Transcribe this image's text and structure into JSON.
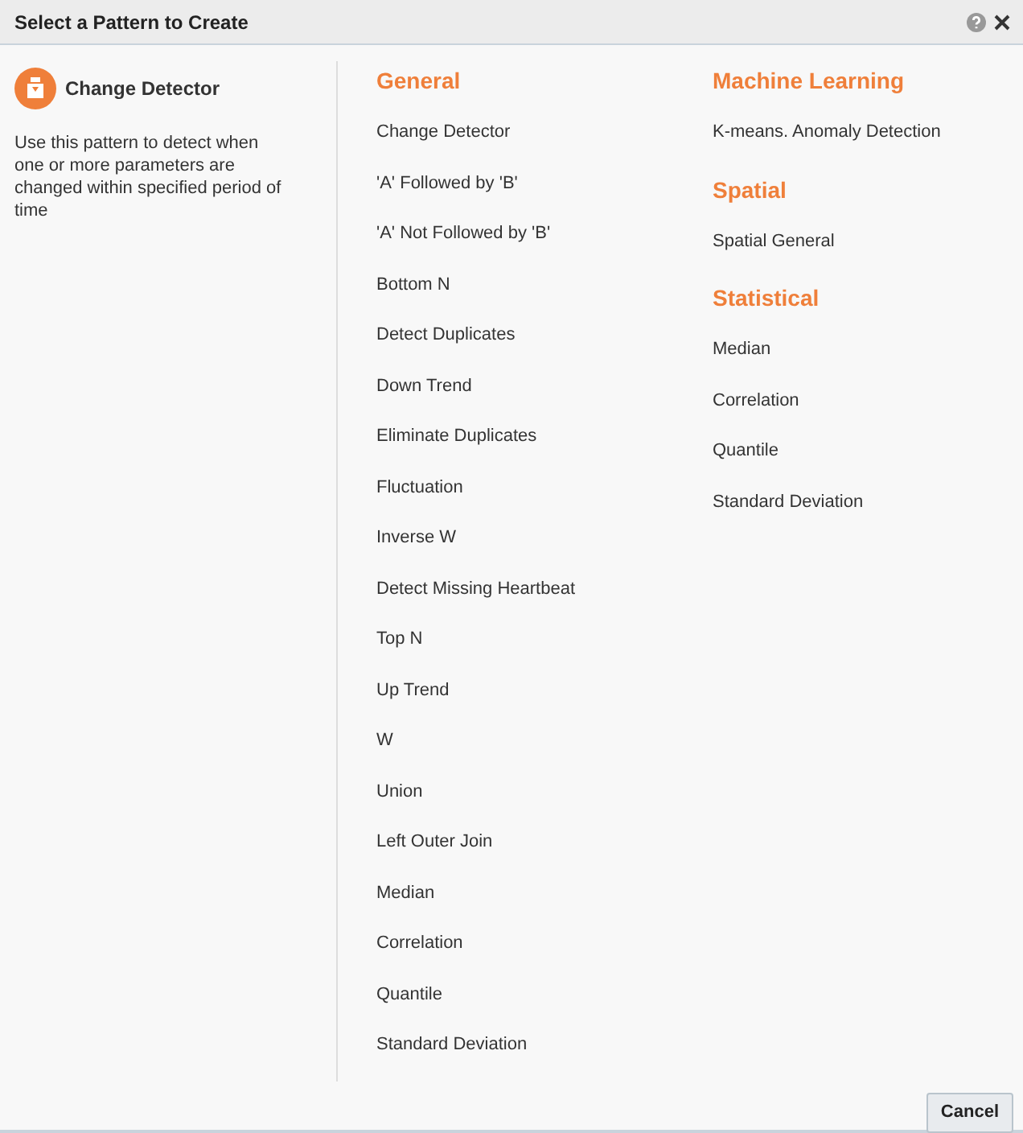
{
  "window": {
    "title": "Select a Pattern to Create"
  },
  "detail": {
    "title": "Change Detector",
    "description": "Use this pattern to detect when one or more parameters are changed within specified period of time"
  },
  "columns": [
    {
      "groups": [
        {
          "heading": "General",
          "items": [
            "Change Detector",
            "'A' Followed by 'B'",
            "'A' Not Followed by 'B'",
            "Bottom N",
            "Detect Duplicates",
            "Down Trend",
            "Eliminate Duplicates",
            "Fluctuation",
            "Inverse W",
            "Detect Missing Heartbeat",
            "Top N",
            "Up Trend",
            "W",
            "Union",
            "Left Outer Join",
            "Median",
            "Correlation",
            "Quantile",
            "Standard Deviation"
          ]
        }
      ]
    },
    {
      "groups": [
        {
          "heading": "Machine Learning",
          "items": [
            "K-means. Anomaly Detection"
          ]
        },
        {
          "heading": "Spatial",
          "items": [
            "Spatial General"
          ]
        },
        {
          "heading": "Statistical",
          "items": [
            "Median",
            "Correlation",
            "Quantile",
            "Standard Deviation"
          ]
        }
      ]
    }
  ],
  "buttons": [
    "Cancel"
  ]
}
